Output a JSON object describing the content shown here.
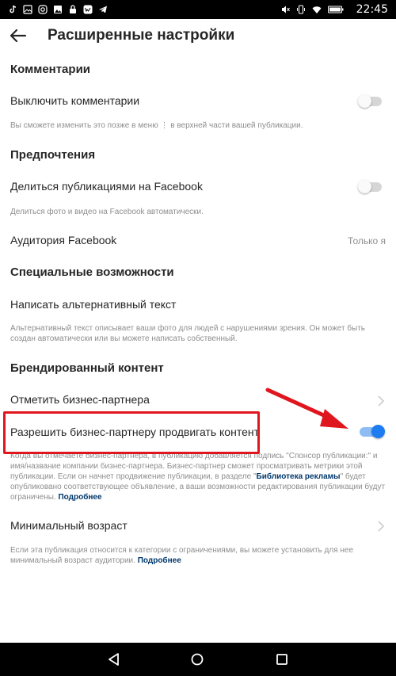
{
  "status_bar": {
    "time": "22:45",
    "left_icons": [
      "tiktok-icon",
      "gallery-icon",
      "instagram-icon",
      "image-icon",
      "lock-icon",
      "vk-icon",
      "telegram-icon"
    ],
    "right_icons": [
      "mute-icon",
      "vibrate-icon",
      "wifi-icon",
      "battery-icon"
    ]
  },
  "header": {
    "title": "Расширенные настройки"
  },
  "comments": {
    "section_title": "Комментарии",
    "toggle_label": "Выключить комментарии",
    "toggle_on": false,
    "description": "Вы сможете изменить это позже в меню ⋮ в верхней части вашей публикации."
  },
  "preferences": {
    "section_title": "Предпочтения",
    "toggle_label": "Делиться публикациями на Facebook",
    "toggle_on": false,
    "description": "Делиться фото и видео на Facebook автоматически.",
    "audience_label": "Аудитория Facebook",
    "audience_value": "Только я"
  },
  "accessibility": {
    "section_title": "Специальные возможности",
    "alt_text_label": "Написать альтернативный текст",
    "description": "Альтернативный текст описывает ваши фото для людей с нарушениями зрения. Он может быть создан автоматически или вы можете написать собственный."
  },
  "branded": {
    "section_title": "Брендированный контент",
    "tag_partner_label": "Отметить бизнес-партнера",
    "allow_promote_label": "Разрешить бизнес-партнеру продвигать контент",
    "allow_promote_on": true,
    "description_part1": "Когда вы отмечаете бизнес-партнера, в публикацию добавляется подпись \"Спонсор публикации:\" и имя/название компании бизнес-партнера. Бизнес-партнер сможет просматривать метрики этой публикации. Если он начнет продвижение публикации, в разделе \"",
    "description_link": "Библиотека рекламы",
    "description_part2": "\" будет опубликовано соответствующее объявление, а ваши возможности редактирования публикации будут ограничены. ",
    "learn_more": "Подробнее"
  },
  "age": {
    "label": "Минимальный возраст",
    "description": "Если эта публикация относится к категории с ограничениями, вы можете установить для нее минимальный возраст аудитории. ",
    "learn_more": "Подробнее"
  },
  "colors": {
    "accent": "#1d7cf2",
    "highlight": "#e0161e",
    "link": "#00376b"
  }
}
